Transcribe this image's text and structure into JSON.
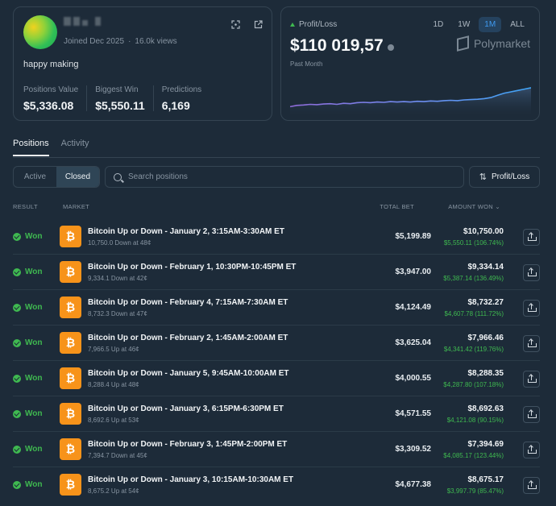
{
  "profile": {
    "joined": "Joined Dec 2025",
    "views": "16.0k views",
    "bio": "happy making",
    "stats": [
      {
        "label": "Positions Value",
        "value": "$5,336.08"
      },
      {
        "label": "Biggest Win",
        "value": "$5,550.11"
      },
      {
        "label": "Predictions",
        "value": "6,169"
      }
    ]
  },
  "pnl": {
    "label": "Profit/Loss",
    "value": "$110 019,57",
    "period": "Past Month",
    "brand": "Polymarket",
    "ranges": [
      "1D",
      "1W",
      "1M",
      "ALL"
    ],
    "active_range": "1M",
    "up_color": "#3fb950",
    "sparkline": [
      0.18,
      0.22,
      0.23,
      0.25,
      0.24,
      0.26,
      0.27,
      0.25,
      0.28,
      0.27,
      0.3,
      0.31,
      0.3,
      0.32,
      0.31,
      0.33,
      0.32,
      0.33,
      0.32,
      0.34,
      0.33,
      0.35,
      0.34,
      0.36,
      0.37,
      0.36,
      0.38,
      0.39,
      0.4,
      0.42,
      0.45,
      0.52,
      0.58,
      0.62,
      0.66,
      0.7,
      0.74
    ]
  },
  "tabs": {
    "positions": "Positions",
    "activity": "Activity"
  },
  "filters": {
    "active": "Active",
    "closed": "Closed",
    "search_placeholder": "Search positions",
    "sort": "Profit/Loss"
  },
  "table": {
    "headers": {
      "result": "RESULT",
      "market": "MARKET",
      "total_bet": "TOTAL BET",
      "amount_won": "AMOUNT WON"
    },
    "rows": [
      {
        "result": "Won",
        "title": "Bitcoin Up or Down - January 2, 3:15AM-3:30AM ET",
        "sub": "10,750.0 Down at 48¢",
        "total": "$5,199.89",
        "amount": "$10,750.00",
        "pnl": "$5,550.11 (106.74%)"
      },
      {
        "result": "Won",
        "title": "Bitcoin Up or Down - February 1, 10:30PM-10:45PM ET",
        "sub": "9,334.1 Down at 42¢",
        "total": "$3,947.00",
        "amount": "$9,334.14",
        "pnl": "$5,387.14 (136.49%)"
      },
      {
        "result": "Won",
        "title": "Bitcoin Up or Down - February 4, 7:15AM-7:30AM ET",
        "sub": "8,732.3 Down at 47¢",
        "total": "$4,124.49",
        "amount": "$8,732.27",
        "pnl": "$4,607.78 (111.72%)"
      },
      {
        "result": "Won",
        "title": "Bitcoin Up or Down - February 2, 1:45AM-2:00AM ET",
        "sub": "7,966.5 Up at 46¢",
        "total": "$3,625.04",
        "amount": "$7,966.46",
        "pnl": "$4,341.42 (119.76%)"
      },
      {
        "result": "Won",
        "title": "Bitcoin Up or Down - January 5, 9:45AM-10:00AM ET",
        "sub": "8,288.4 Up at 48¢",
        "total": "$4,000.55",
        "amount": "$8,288.35",
        "pnl": "$4,287.80 (107.18%)"
      },
      {
        "result": "Won",
        "title": "Bitcoin Up or Down - January 3, 6:15PM-6:30PM ET",
        "sub": "8,692.6 Up at 53¢",
        "total": "$4,571.55",
        "amount": "$8,692.63",
        "pnl": "$4,121.08 (90.15%)"
      },
      {
        "result": "Won",
        "title": "Bitcoin Up or Down - February 3, 1:45PM-2:00PM ET",
        "sub": "7,394.7 Down at 45¢",
        "total": "$3,309.52",
        "amount": "$7,394.69",
        "pnl": "$4,085.17 (123.44%)"
      },
      {
        "result": "Won",
        "title": "Bitcoin Up or Down - January 3, 10:15AM-10:30AM ET",
        "sub": "8,675.2 Up at 54¢",
        "total": "$4,677.38",
        "amount": "$8,675.17",
        "pnl": "$3,997.79 (85.47%)"
      }
    ]
  }
}
